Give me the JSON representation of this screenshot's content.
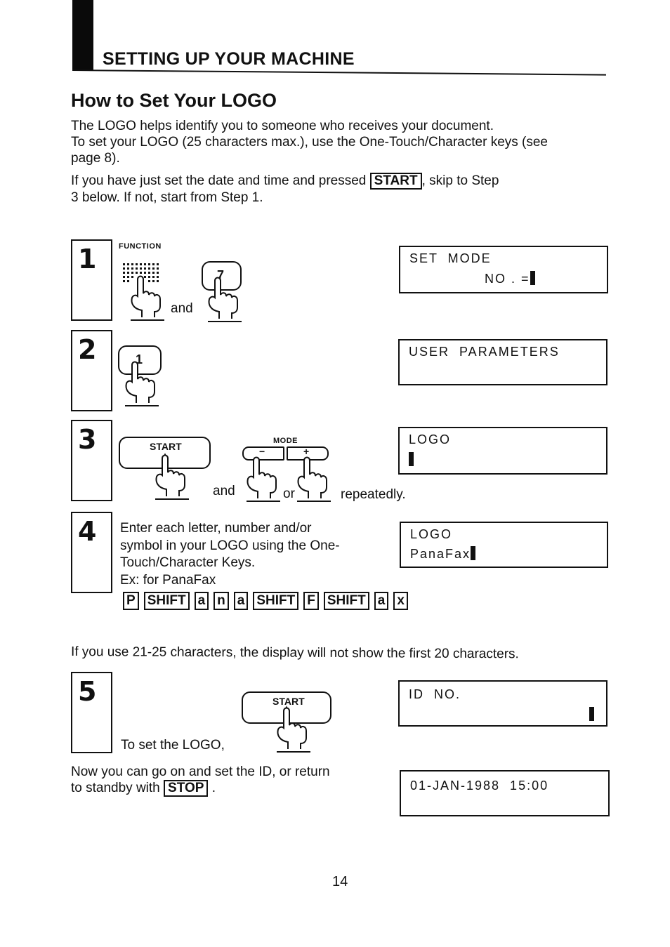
{
  "header": {
    "section_title": "SETTING UP YOUR MACHINE",
    "page_heading": "How to Set Your LOGO"
  },
  "intro": {
    "line1": "The LOGO helps identify you to someone who receives your document.",
    "line2": "To set your LOGO (25 characters max.), use the One-Touch/Character keys (see",
    "line3": "page 8).",
    "line4_pre": "If you have just set the date and time and pressed",
    "line4_key": "START",
    "line4_post": ", skip to Step",
    "line5": "3 below.  If not, start from Step 1."
  },
  "steps": [
    {
      "number": "1",
      "function_label": "FUNCTION",
      "key_label": "7",
      "connector": "and",
      "display": {
        "line1": "SET  MODE",
        "line2": "NO . ="
      }
    },
    {
      "number": "2",
      "key_label": "1",
      "display": {
        "line1": "USER  PARAMETERS",
        "line2": ""
      }
    },
    {
      "number": "3",
      "start_label": "START",
      "mode_label": "MODE",
      "minus_label": "−",
      "plus_label": "+",
      "connector_and": "and",
      "connector_or": "or",
      "suffix": "repeatedly.",
      "display": {
        "line1": "LOGO",
        "line2": ""
      }
    },
    {
      "number": "4",
      "text_line1": "Enter each letter, number and/or",
      "text_line2": "symbol in your LOGO using the One-",
      "text_line3": "Touch/Character Keys.",
      "text_line4": "Ex: for PanaFax",
      "keys": [
        "P",
        "SHIFT",
        "a",
        "n",
        "a",
        "SHIFT",
        "F",
        "SHIFT",
        "a",
        "x"
      ],
      "display": {
        "line1": "LOGO",
        "line2": "PanaFax"
      }
    },
    {
      "number": "5",
      "text": "To set the LOGO,",
      "start_label": "START",
      "display": {
        "line1": "ID  NO.",
        "line2": ""
      }
    }
  ],
  "note": "If you use 21-25 characters, the display will not show the first 20 characters.",
  "closing": {
    "line1": "Now you can go on and set the ID, or return",
    "line2_pre": "to standby with",
    "line2_key": "STOP",
    "line2_post": ".",
    "display_line1": "01-JAN-1988  15:00"
  },
  "page_number": "14"
}
